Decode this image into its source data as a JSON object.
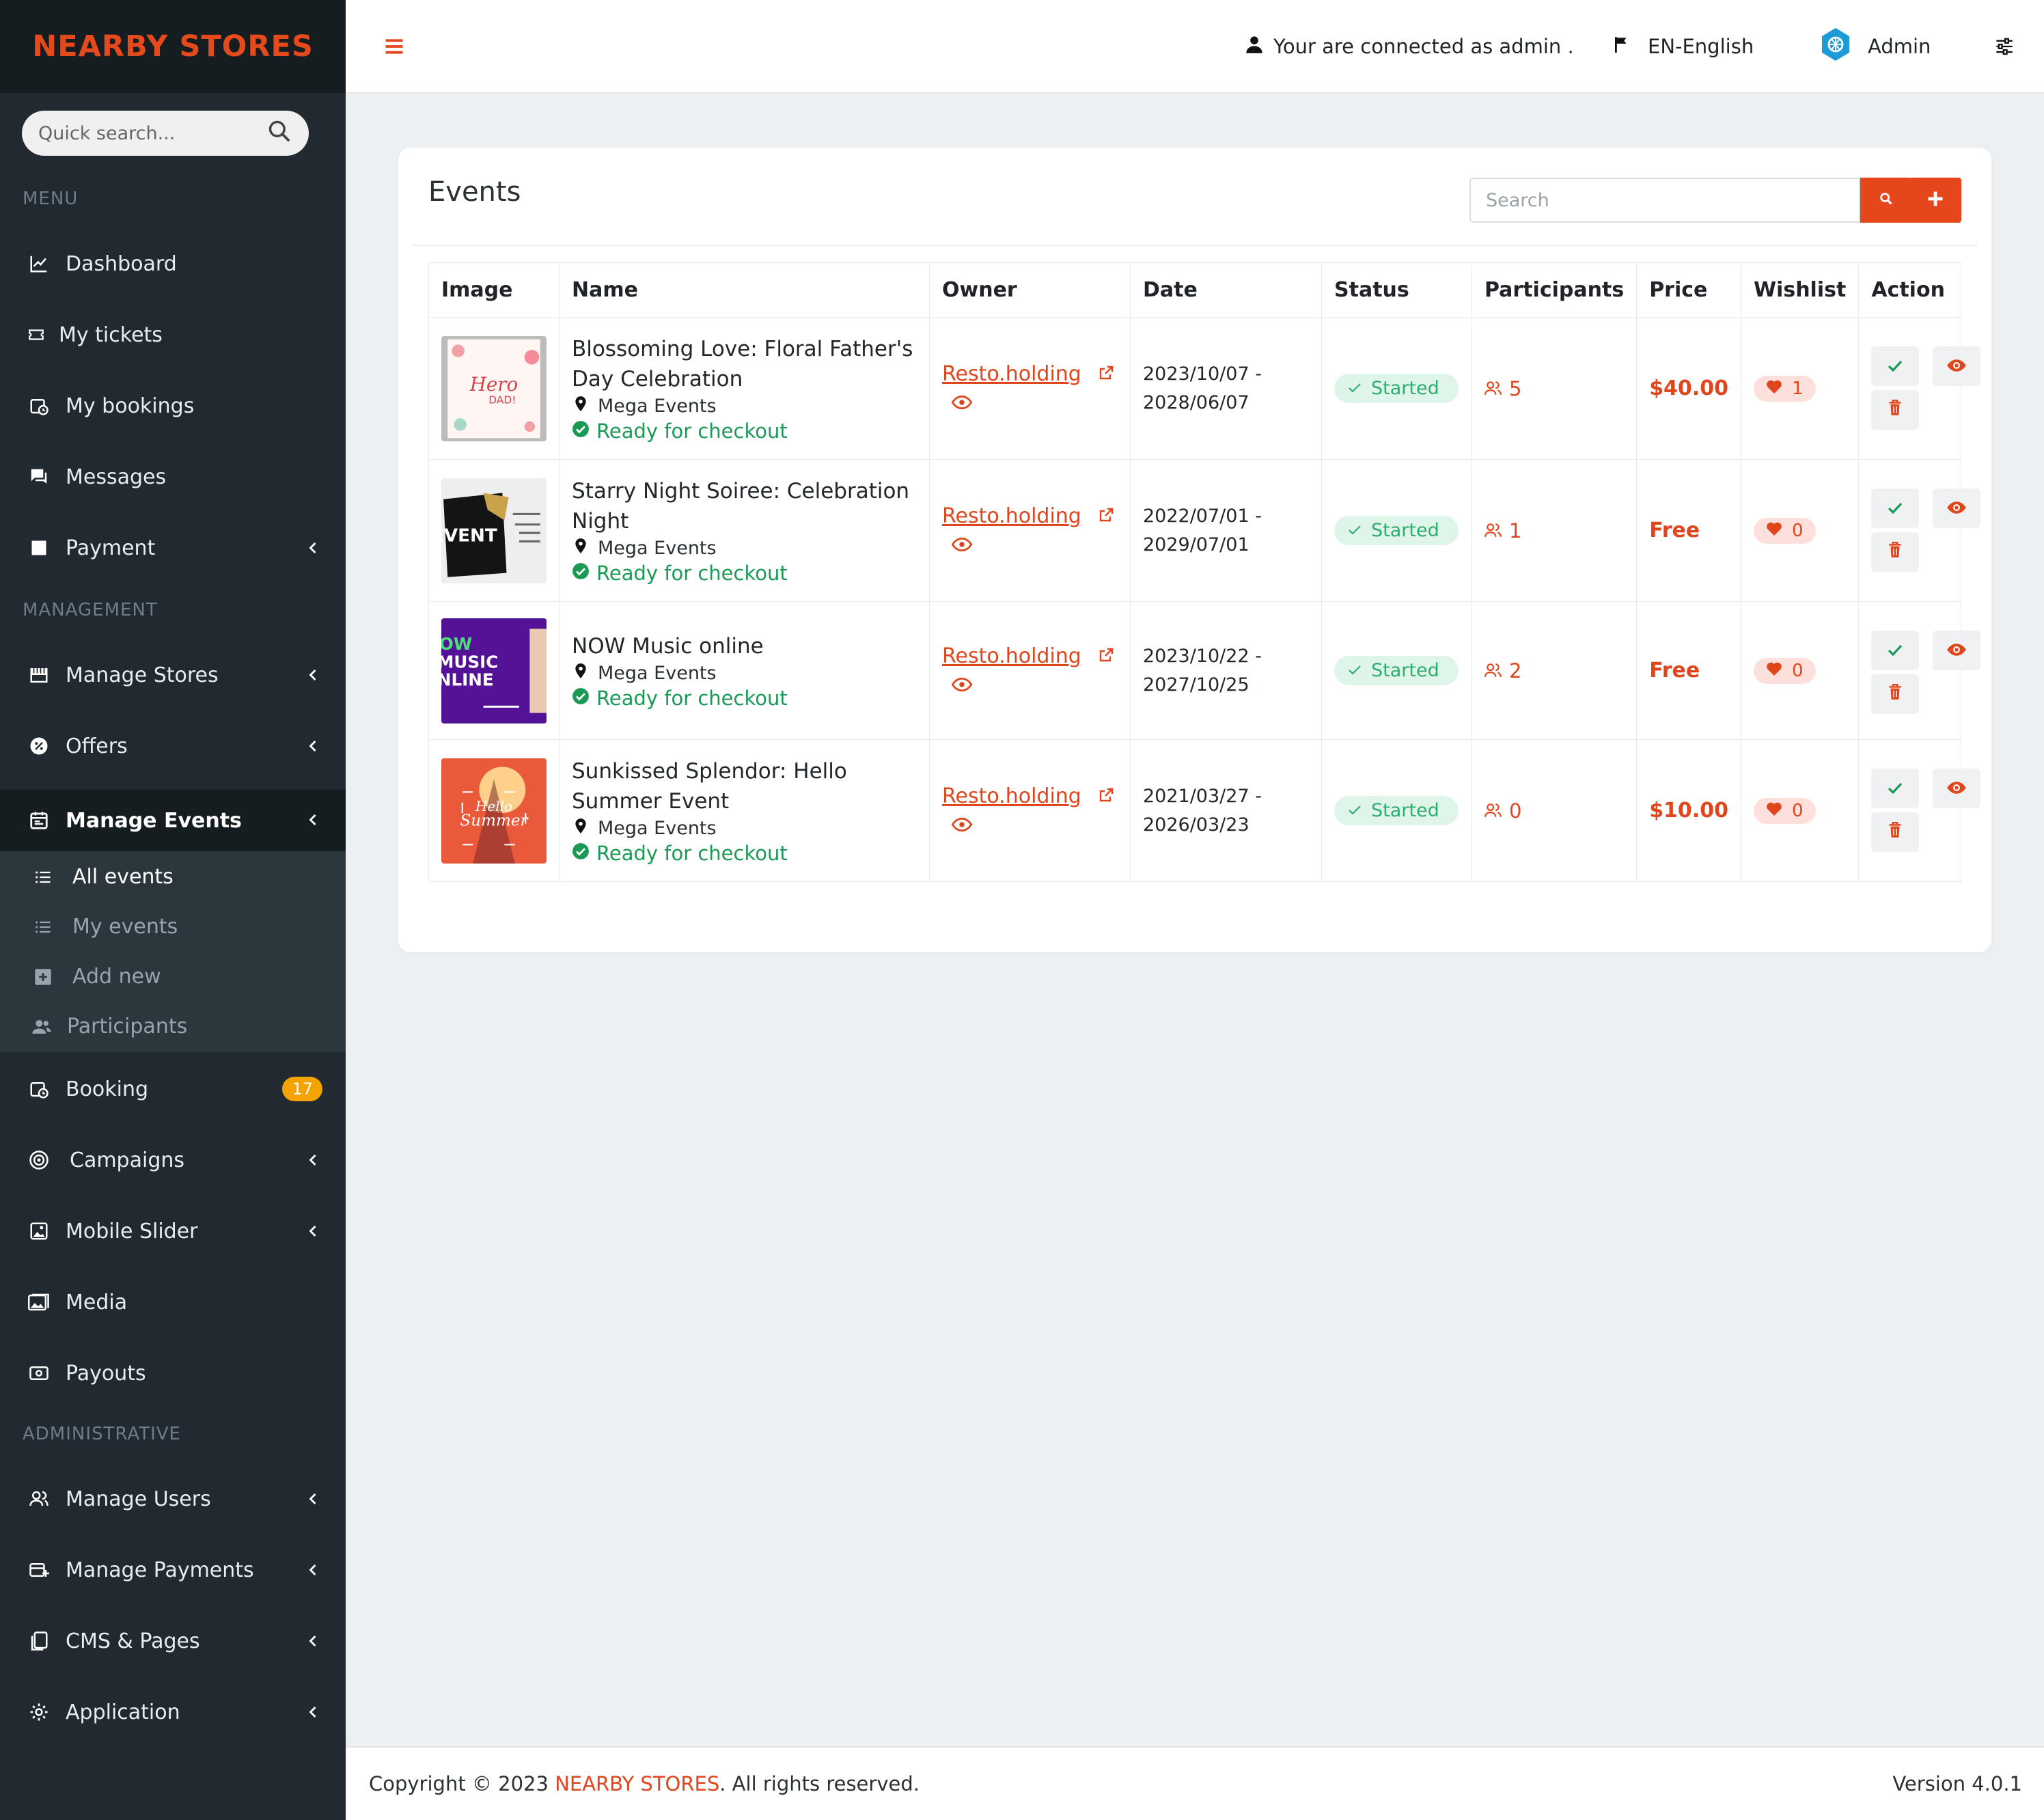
{
  "brand": "NEARBY STORES",
  "quick_search_placeholder": "Quick search...",
  "sections": {
    "menu": "MENU",
    "management": "MANAGEMENT",
    "administrative": "ADMINISTRATIVE"
  },
  "menu": {
    "dashboard": "Dashboard",
    "tickets": "My tickets",
    "bookings": "My bookings",
    "messages": "Messages",
    "payment": "Payment"
  },
  "management": {
    "stores": "Manage Stores",
    "offers": "Offers",
    "events": "Manage Events",
    "sub": {
      "all": "All events",
      "mine": "My events",
      "add": "Add new",
      "participants": "Participants"
    },
    "booking": "Booking",
    "booking_badge": "17",
    "campaigns": "Campaigns",
    "slider": "Mobile Slider",
    "media": "Media",
    "payouts": "Payouts"
  },
  "admin": {
    "users": "Manage Users",
    "payments": "Manage Payments",
    "cms": "CMS & Pages",
    "application": "Application"
  },
  "topbar": {
    "connected": "Your are connected as admin .",
    "language": "EN-English",
    "user": "Admin"
  },
  "page": {
    "title": "Events",
    "search_placeholder": "Search",
    "columns": [
      "Image",
      "Name",
      "Owner",
      "Date",
      "Status",
      "Participants",
      "Price",
      "Wishlist",
      "Action"
    ]
  },
  "events": [
    {
      "name": "Blossoming Love: Floral Father's Day Celebration",
      "location": "Mega Events",
      "ready": "Ready for checkout",
      "owner": "Resto.holding",
      "date_start": "2023/10/07 -",
      "date_end": "2028/06/07",
      "status": "Started",
      "participants": "5",
      "price": "$40.00",
      "wishlist": "1",
      "image_text": "Hero DAD!"
    },
    {
      "name": "Starry Night Soiree: Celebration Night",
      "location": "Mega Events",
      "ready": "Ready for checkout",
      "owner": "Resto.holding",
      "date_start": "2022/07/01 -",
      "date_end": "2029/07/01",
      "status": "Started",
      "participants": "1",
      "price": "Free",
      "wishlist": "0",
      "image_text": "EVENT"
    },
    {
      "name": "NOW Music online",
      "location": "Mega Events",
      "ready": "Ready for checkout",
      "owner": "Resto.holding",
      "date_start": "2023/10/22 -",
      "date_end": "2027/10/25",
      "status": "Started",
      "participants": "2",
      "price": "Free",
      "wishlist": "0",
      "image_text": "OW MUSIC NLINE"
    },
    {
      "name": "Sunkissed Splendor: Hello Summer Event",
      "location": "Mega Events",
      "ready": "Ready for checkout",
      "owner": "Resto.holding",
      "date_start": "2021/03/27 -",
      "date_end": "2026/03/23",
      "status": "Started",
      "participants": "0",
      "price": "$10.00",
      "wishlist": "0",
      "image_text": "Hello Summer"
    }
  ],
  "footer": {
    "copyright_prefix": "Copyright © 2023 ",
    "brand": "NEARBY STORES",
    "copyright_suffix": ". All rights reserved.",
    "version": "Version 4.0.1"
  },
  "colors": {
    "accent": "#e5461c",
    "sidebar": "#212a30",
    "success": "#1a9a55"
  }
}
